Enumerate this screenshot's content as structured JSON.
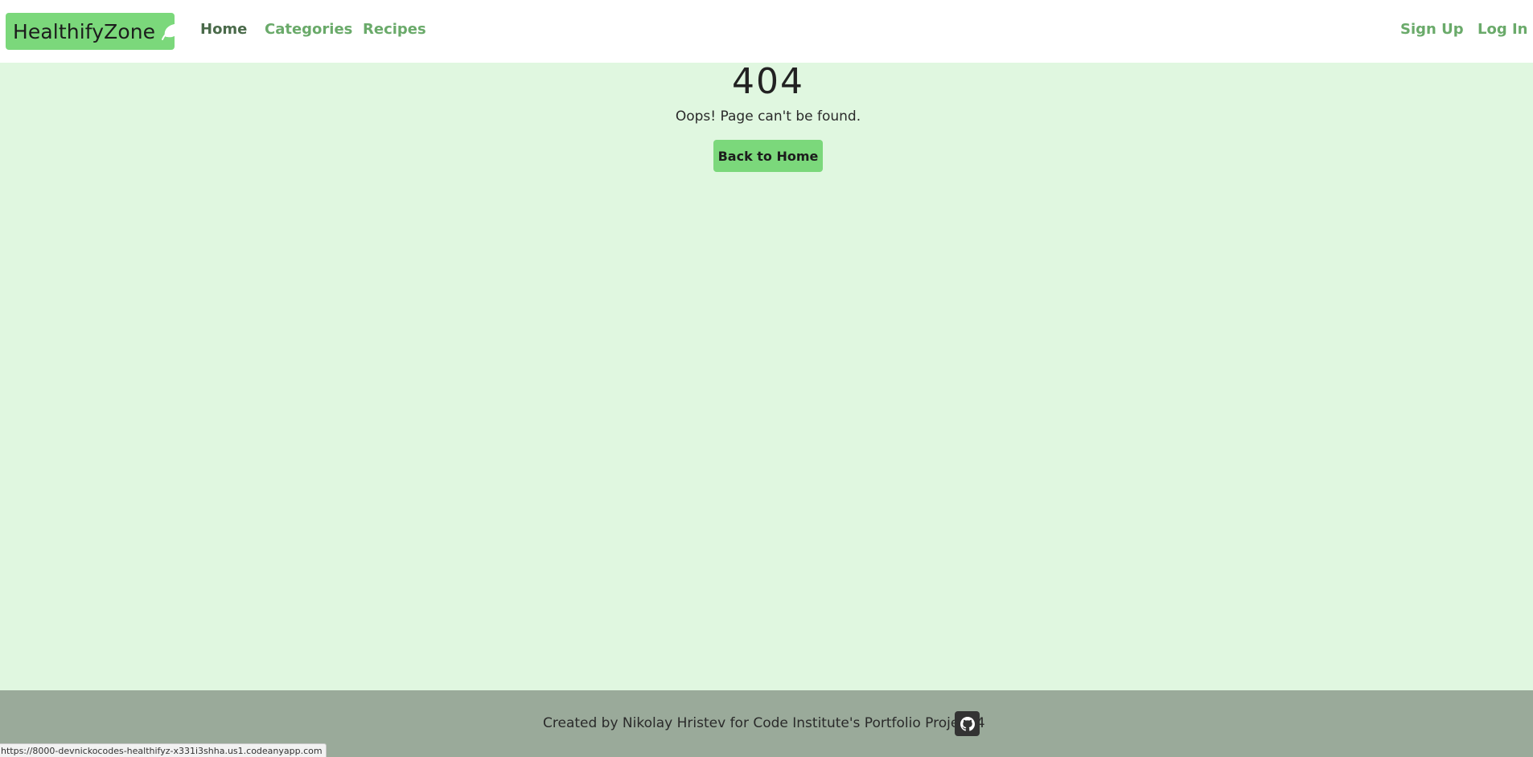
{
  "navbar": {
    "brand": "HealthifyZone",
    "brand_icon": "leaf-icon",
    "links": [
      "Home",
      "Categories",
      "Recipes"
    ],
    "auth": {
      "signup": "Sign Up",
      "login": "Log In"
    }
  },
  "main": {
    "error_code": "404",
    "message": "Oops! Page can't be found.",
    "back_button": "Back to Home"
  },
  "footer": {
    "text": "Created by Nikolay Hristev for Code Institute's Portfolio Project 4",
    "github_icon": "github-icon"
  },
  "status_bar": {
    "url": "https://8000-devnickocodes-healthifyz-x331i3shha.us1.codeanyapp.com"
  },
  "colors": {
    "brand_green": "#7bd87b",
    "page_background": "#e0f7e0",
    "footer_background": "#9aaa9a",
    "link_green": "#6aaa6a"
  }
}
